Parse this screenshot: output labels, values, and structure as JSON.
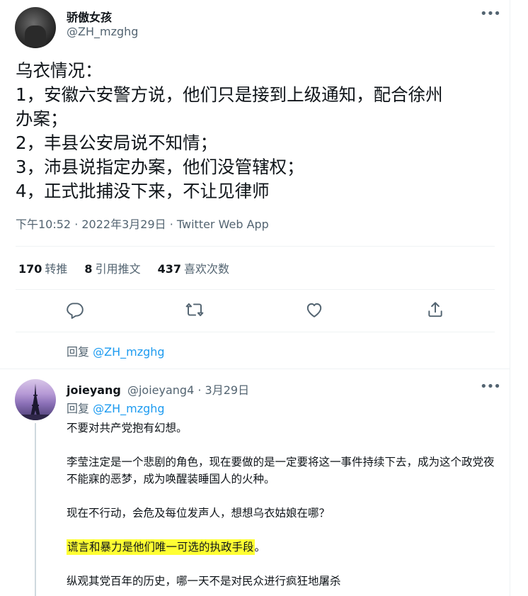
{
  "tweet": {
    "author_name": "骄傲女孩",
    "author_handle": "@ZH_mzghg",
    "lines": [
      "乌衣情况：",
      "1，安徽六安警方说，他们只是接到上级通知，配合徐州",
      "办案；",
      "2，丰县公安局说不知情；",
      "3，沛县说指定办案，他们没管辖权；",
      "4，正式批捕没下来，不让见律师"
    ],
    "meta": "下午10:52 · 2022年3月29日 · Twitter Web App",
    "stats": {
      "retweets_count": "170",
      "retweets_label": "转推",
      "quotes_count": "8",
      "quotes_label": "引用推文",
      "likes_count": "437",
      "likes_label": "喜欢次数"
    },
    "actions": [
      "reply-icon",
      "retweet-icon",
      "like-icon",
      "share-icon"
    ],
    "reply_prefix": "回复",
    "reply_handle": "@ZH_mzghg"
  },
  "reply": {
    "name": "joieyang",
    "handle": "@joieyang4",
    "date": "· 3月29日",
    "reply_prefix": "回复",
    "reply_handle": "@ZH_mzghg",
    "paragraphs": [
      "不要对共产党抱有幻想。",
      "李莹注定是一个悲剧的角色，现在要做的是一定要将这一事件持续下去，成为这个政党夜不能寐的恶梦，成为唤醒装睡国人的火种。",
      "现在不行动，会危及每位发声人，想想乌衣姑娘在哪？"
    ],
    "highlight_text": "谎言和暴力是他们唯一可选的执政手段",
    "highlight_suffix": "。",
    "last_paragraph": "纵观其党百年的历史，哪一天不是对民众进行疯狂地屠杀"
  },
  "colors": {
    "link": "#1d9bf0",
    "secondary_text": "#536471",
    "highlight": "#ffff33"
  }
}
